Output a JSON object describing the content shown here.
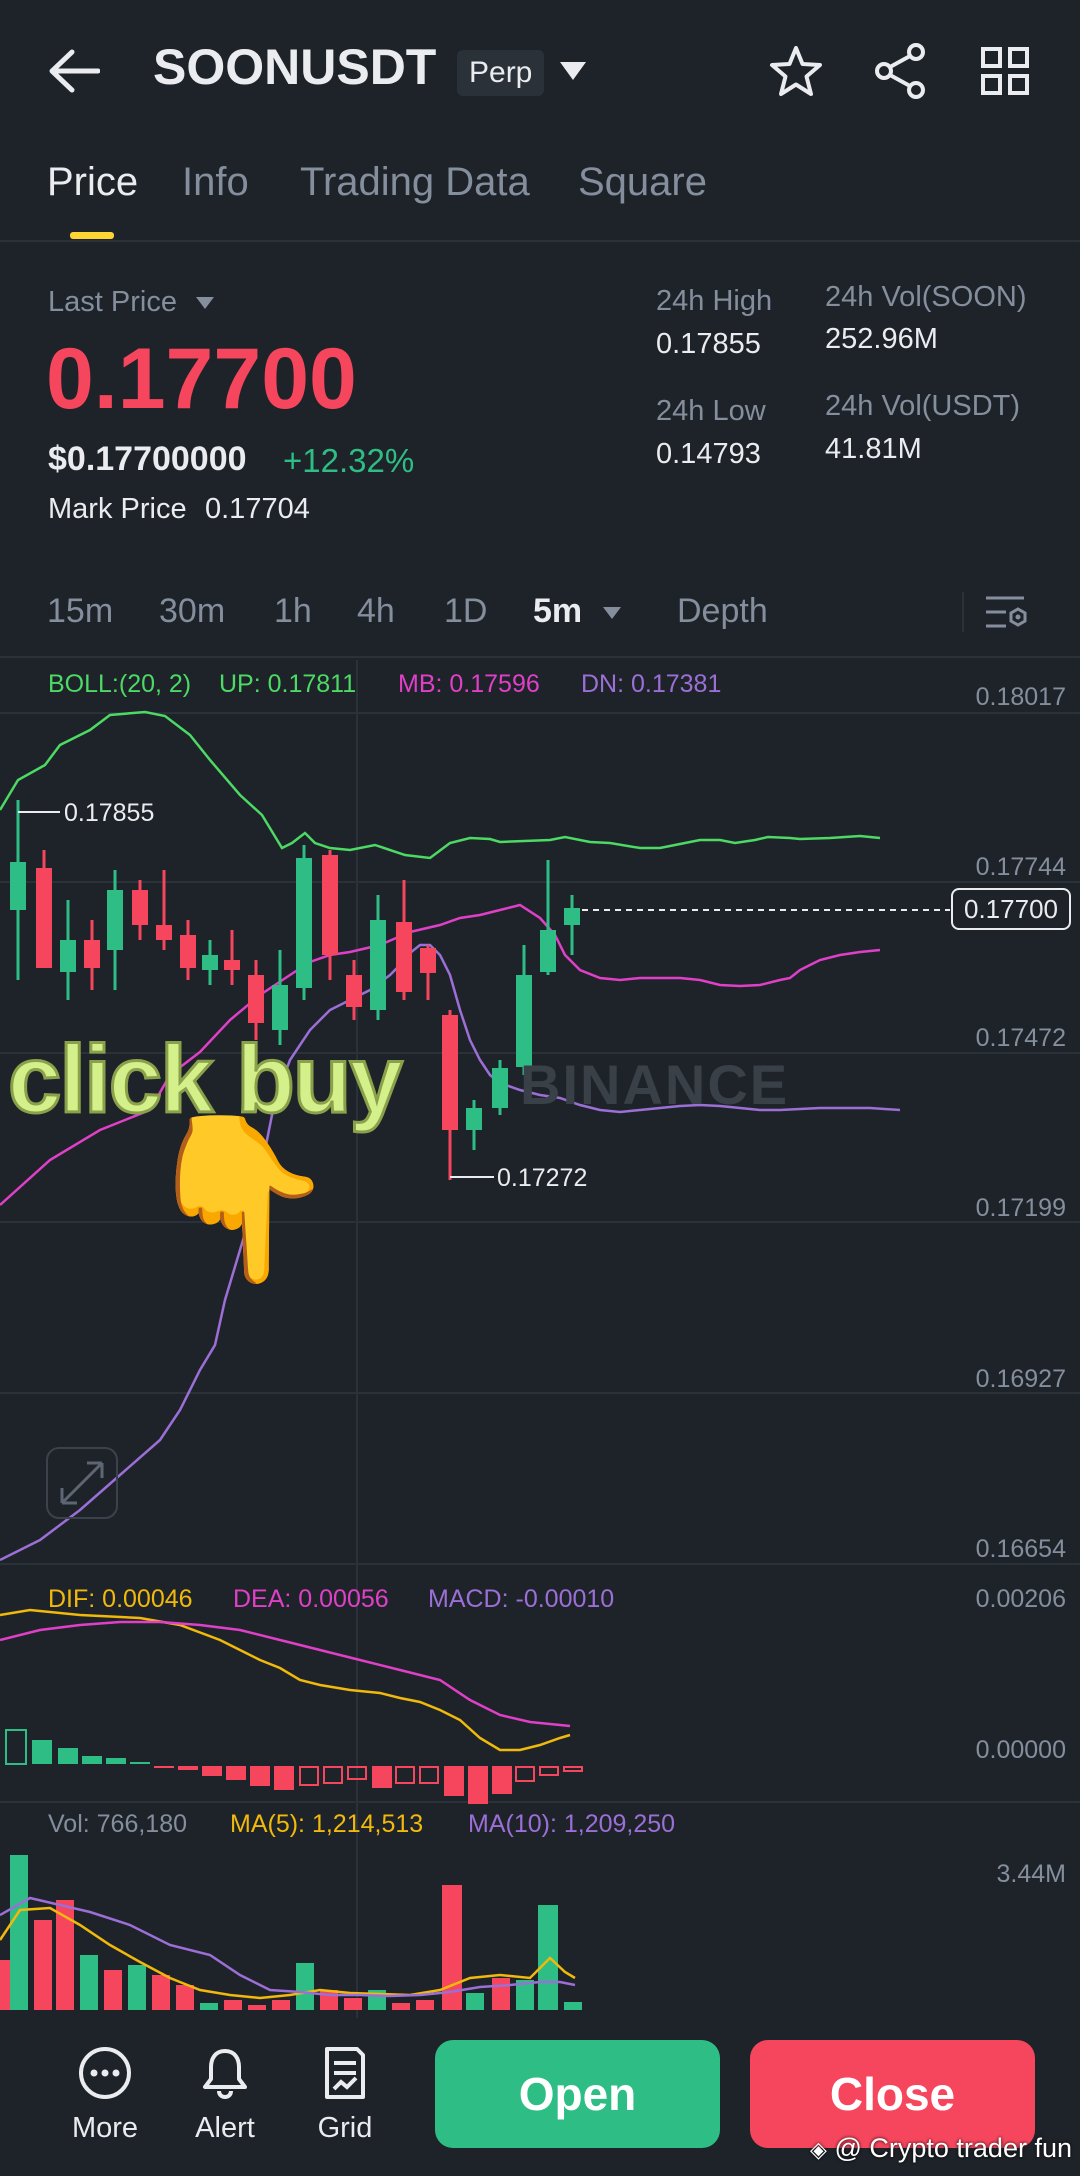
{
  "header": {
    "symbol": "SOONUSDT",
    "badge": "Perp"
  },
  "tabs": [
    "Price",
    "Info",
    "Trading Data",
    "Square"
  ],
  "price": {
    "last_price_label": "Last Price",
    "last_price": "0.17700",
    "usd_price": "$0.17700000",
    "change": "+12.32%",
    "mark_label": "Mark Price",
    "mark_value": "0.17704",
    "high_label": "24h High",
    "high_value": "0.17855",
    "low_label": "24h Low",
    "low_value": "0.14793",
    "vol_soon_label": "24h Vol(SOON)",
    "vol_soon_value": "252.96M",
    "vol_usdt_label": "24h Vol(USDT)",
    "vol_usdt_value": "41.81M"
  },
  "timeframes": [
    "15m",
    "30m",
    "1h",
    "4h",
    "1D",
    "5m",
    "Depth"
  ],
  "indicators": {
    "boll": "BOLL:(20, 2)",
    "up": "UP: 0.17811",
    "mb": "MB: 0.17596",
    "dn": "DN: 0.17381",
    "dif": "DIF: 0.00046",
    "dea": "DEA: 0.00056",
    "macd": "MACD: -0.00010",
    "vol": "Vol: 766,180",
    "ma5": "MA(5): 1,214,513",
    "ma10": "MA(10): 1,209,250"
  },
  "axis": {
    "price_ticks": [
      "0.18017",
      "0.17744",
      "0.17472",
      "0.17199",
      "0.16927",
      "0.16654"
    ],
    "current_price_tag": "0.17700",
    "high_marker": "0.17855",
    "low_marker": "0.17272",
    "macd_ticks": [
      "0.00206",
      "0.00000"
    ],
    "vol_tick": "3.44M"
  },
  "overlay": {
    "caption": "click buy",
    "pointer_emoji": "👇",
    "logo_text": "BINANCE"
  },
  "bottom": {
    "more": "More",
    "alert": "Alert",
    "grid": "Grid",
    "open": "Open",
    "close": "Close"
  },
  "watermark": "@ Crypto trader fun",
  "colors": {
    "background": "#1e2329",
    "up": "#2ebd85",
    "down": "#f6465d",
    "accent": "#fcd535",
    "boll_up": "#4cd964",
    "boll_mb": "#e040c8",
    "boll_dn": "#9b6fd6"
  }
}
